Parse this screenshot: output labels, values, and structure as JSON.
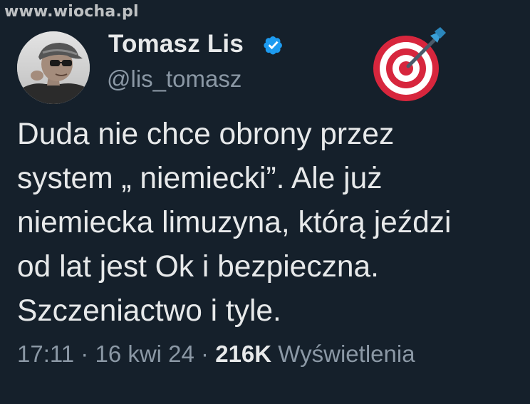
{
  "watermark": "www.wiocha.pl",
  "author": {
    "display_name": "Tomasz Lis",
    "handle": "@lis_tomasz",
    "verified_icon": "verified-badge-icon",
    "avatar": "profile-photo"
  },
  "emoji": "direct-hit-target",
  "tweet": {
    "text": "Duda nie chce obrony przez\nsystem „ niemiecki”. Ale już\nniemiecka limuzyna, którą jeździ\nod lat jest Ok i bezpieczna.\nSzczeniactwo i tyle."
  },
  "meta": {
    "time": "17:11",
    "separator1": " · ",
    "date": "16 kwi 24",
    "separator2": " · ",
    "views_count": "216K",
    "views_label": " Wyświetlenia"
  },
  "colors": {
    "background": "#15202b",
    "text_primary": "#e7e9ea",
    "text_secondary": "#8b98a5",
    "verified": "#1d9bf0",
    "target_red": "#d7263d"
  }
}
